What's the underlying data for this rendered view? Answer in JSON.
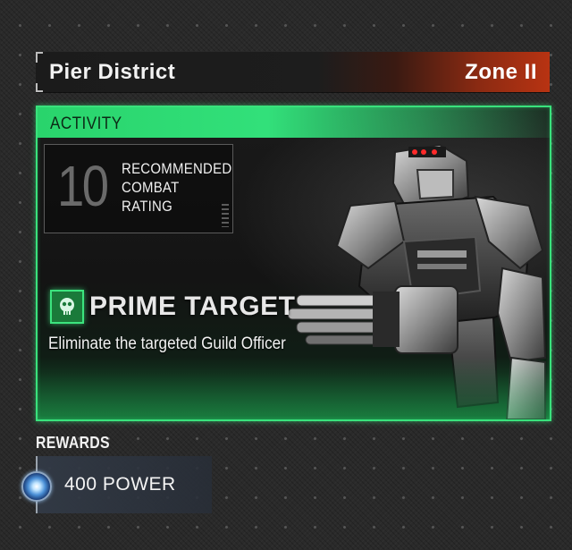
{
  "header": {
    "district": "Pier District",
    "zone": "Zone II"
  },
  "activity": {
    "label": "ACTIVITY",
    "recommended_rating": "10",
    "rating_caption": "RECOMMENDED\nCOMBAT\nRATING",
    "target_icon": "skull-icon",
    "target_title": "PRIME TARGET",
    "target_description": "Eliminate the targeted Guild Officer"
  },
  "rewards": {
    "heading": "REWARDS",
    "items": [
      {
        "icon": "power-orb-icon",
        "label": "400 POWER"
      }
    ]
  },
  "colors": {
    "accent_green": "#39e27c",
    "zone_red": "#b83312",
    "reward_panel": "#323a46"
  }
}
